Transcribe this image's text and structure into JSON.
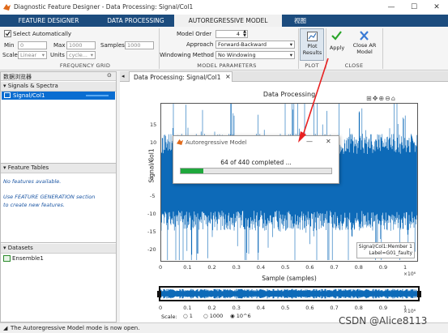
{
  "window": {
    "title": "Diagnostic Feature Designer - Data Processing: Signal/Col1",
    "minimize": "—",
    "maximize": "☐",
    "close": "✕"
  },
  "tabs": [
    "FEATURE DESIGNER",
    "DATA PROCESSING",
    "AUTOREGRESSIVE MODEL",
    "视图"
  ],
  "ribbon": {
    "select_automatically": "Select Automatically",
    "min_label": "Min",
    "min_value": "0",
    "max_label": "Max",
    "max_value": "1000",
    "samples_label": "Samples",
    "samples_value": "1000",
    "scale_label": "Scale",
    "scale_value": "Linear",
    "units_label": "Units",
    "units_value": "cycle...",
    "freq_grid": "FREQUENCY GRID",
    "model_order_label": "Model Order",
    "model_order_value": "4",
    "approach_label": "Approach",
    "approach_value": "Forward-Backward",
    "windowing_label": "Windowing Method",
    "windowing_value": "No Windowing",
    "model_params": "MODEL PARAMETERS",
    "plot_results": "Plot Results",
    "plot_section": "PLOT",
    "apply": "Apply",
    "close_ar": "Close AR Model",
    "close_section": "CLOSE"
  },
  "browser": {
    "title": "数据浏览器",
    "signals_header": "Signals & Spectra",
    "signal_item": "Signal/Col1",
    "features_header": "Feature Tables",
    "no_features": "No features available.",
    "hint_line1": "Use FEATURE GENERATION section",
    "hint_line2": "to create new features.",
    "datasets_header": "Datasets",
    "dataset_item": "Ensemble1"
  },
  "doc": {
    "tab": "Data Processing: Signal/Col1",
    "close": "×"
  },
  "plot": {
    "title": "Data Processing",
    "ylabel": "Signal/Col1",
    "xlabel": "Sample (samples)",
    "yticks": [
      "15",
      "10",
      "5",
      "0",
      "-5",
      "-10",
      "-15",
      "-20"
    ],
    "xticks": [
      "0",
      "0.1",
      "0.2",
      "0.3",
      "0.4",
      "0.5",
      "0.6",
      "0.7",
      "0.8",
      "0.9",
      "1"
    ],
    "exp": "×10⁶",
    "legend_line1": "Signal/Col1:Member 1",
    "legend_line2": "Label=G01_faulty",
    "series_color": "#0d6ab8"
  },
  "overview": {
    "xticks": [
      "0",
      "0.1",
      "0.2",
      "0.3",
      "0.4",
      "0.5",
      "0.6",
      "0.7",
      "0.8",
      "0.9",
      "1"
    ],
    "exp": "×10⁶",
    "scale_label": "Scale:",
    "opt1": "1",
    "opt2": "1000",
    "opt3": "10^6"
  },
  "dialog": {
    "title": "Autoregressive Model",
    "minimize": "—",
    "close": "✕",
    "message": "64 of 440 completed ...",
    "progress": 0.15,
    "accent": "#1fa83c"
  },
  "status": {
    "message": "The Autoregressive Model mode is now open."
  },
  "watermark": "CSDN @Alice8113"
}
